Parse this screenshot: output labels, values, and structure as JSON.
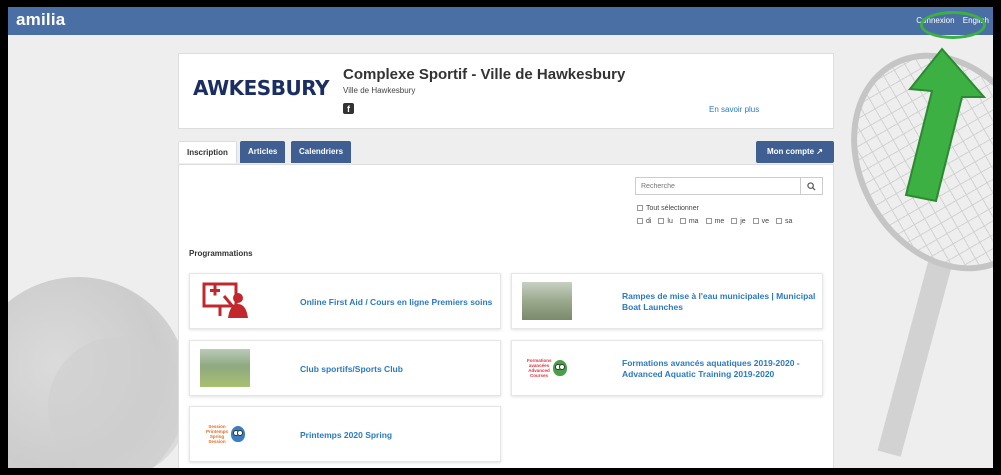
{
  "topbar": {
    "logo": "amilia",
    "login": "Connexion",
    "language": "English",
    "bg_color": "#4a6fa5"
  },
  "header": {
    "brand_logo_text": "AWKESBURY",
    "title": "Complexe Sportif - Ville de Hawkesbury",
    "subtitle": "Ville de Hawkesbury",
    "facebook_icon": "facebook-icon",
    "learn_more": "En savoir plus"
  },
  "tabs": [
    {
      "label": "Inscription",
      "active": true
    },
    {
      "label": "Articles",
      "active": false
    },
    {
      "label": "Calendriers",
      "active": false
    }
  ],
  "account_button": "Mon compte ↗",
  "search": {
    "placeholder": "Recherche",
    "button_icon": "search-icon"
  },
  "filters": {
    "select_all": "Tout sélectionner",
    "days": [
      "di",
      "lu",
      "ma",
      "me",
      "je",
      "ve",
      "sa"
    ]
  },
  "programs": {
    "heading": "Programmations",
    "items": [
      {
        "label": "Online First Aid / Cours en ligne Premiers soins"
      },
      {
        "label": "Rampes de mise à l'eau municipales | Municipal Boat Launches"
      },
      {
        "label": "Club sportifs/Sports Club"
      },
      {
        "label": "Formations avancés aquatiques 2019-2020 - Advanced Aquatic Training 2019-2020"
      },
      {
        "label": "Printemps 2020 Spring"
      }
    ],
    "thumb_text_aquatic": "Formations avancées Advanced Courses",
    "thumb_text_spring": "Session Printemps Spring Session"
  },
  "colors": {
    "link": "#2a7ac2",
    "tab_bg": "#3f5f93",
    "annotation": "#3cb043"
  }
}
